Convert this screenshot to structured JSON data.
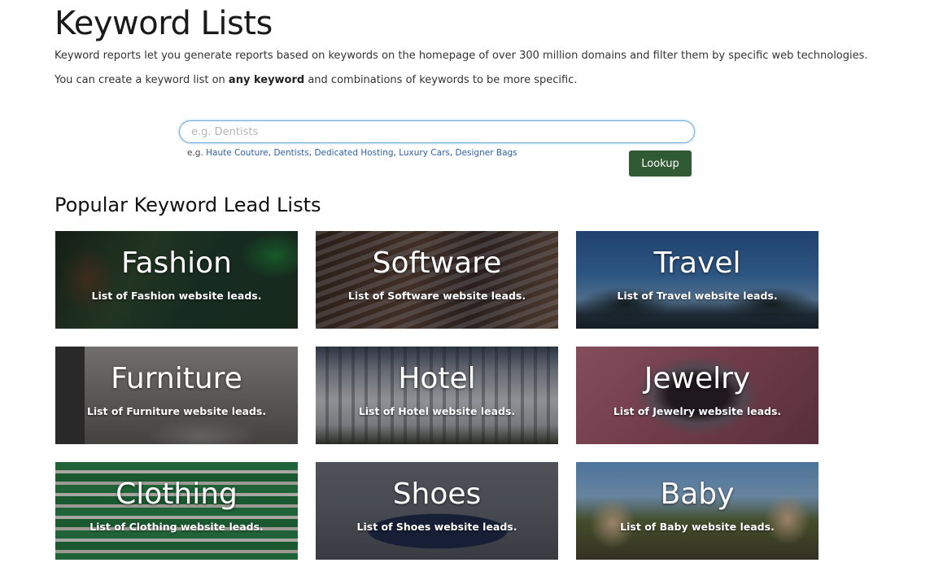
{
  "header": {
    "title": "Keyword Lists",
    "intro_1": "Keyword reports let you generate reports based on keywords on the homepage of over 300 million domains and filter them by specific web technologies.",
    "intro_2_prefix": "You can create a keyword list on ",
    "intro_2_bold": "any keyword",
    "intro_2_suffix": " and combinations of keywords to be more specific."
  },
  "search": {
    "placeholder": "e.g. Dentists",
    "value": "",
    "examples_prefix": "e.g. ",
    "examples": [
      "Haute Couture",
      "Dentists",
      "Dedicated Hosting",
      "Luxury Cars",
      "Designer Bags"
    ],
    "separator": ", ",
    "lookup_label": "Lookup"
  },
  "popular": {
    "heading": "Popular Keyword Lead Lists",
    "tiles": [
      {
        "title": "Fashion",
        "subtitle": "List of Fashion website leads."
      },
      {
        "title": "Software",
        "subtitle": "List of Software website leads."
      },
      {
        "title": "Travel",
        "subtitle": "List of Travel website leads."
      },
      {
        "title": "Furniture",
        "subtitle": "List of Furniture website leads."
      },
      {
        "title": "Hotel",
        "subtitle": "List of Hotel website leads."
      },
      {
        "title": "Jewelry",
        "subtitle": "List of Jewelry website leads."
      },
      {
        "title": "Clothing",
        "subtitle": "List of Clothing website leads."
      },
      {
        "title": "Shoes",
        "subtitle": "List of Shoes website leads."
      },
      {
        "title": "Baby",
        "subtitle": "List of Baby website leads."
      }
    ]
  },
  "colors": {
    "lookup_button": "#2f5a33",
    "link": "#2d61a8",
    "input_border": "#6fa9d8"
  }
}
